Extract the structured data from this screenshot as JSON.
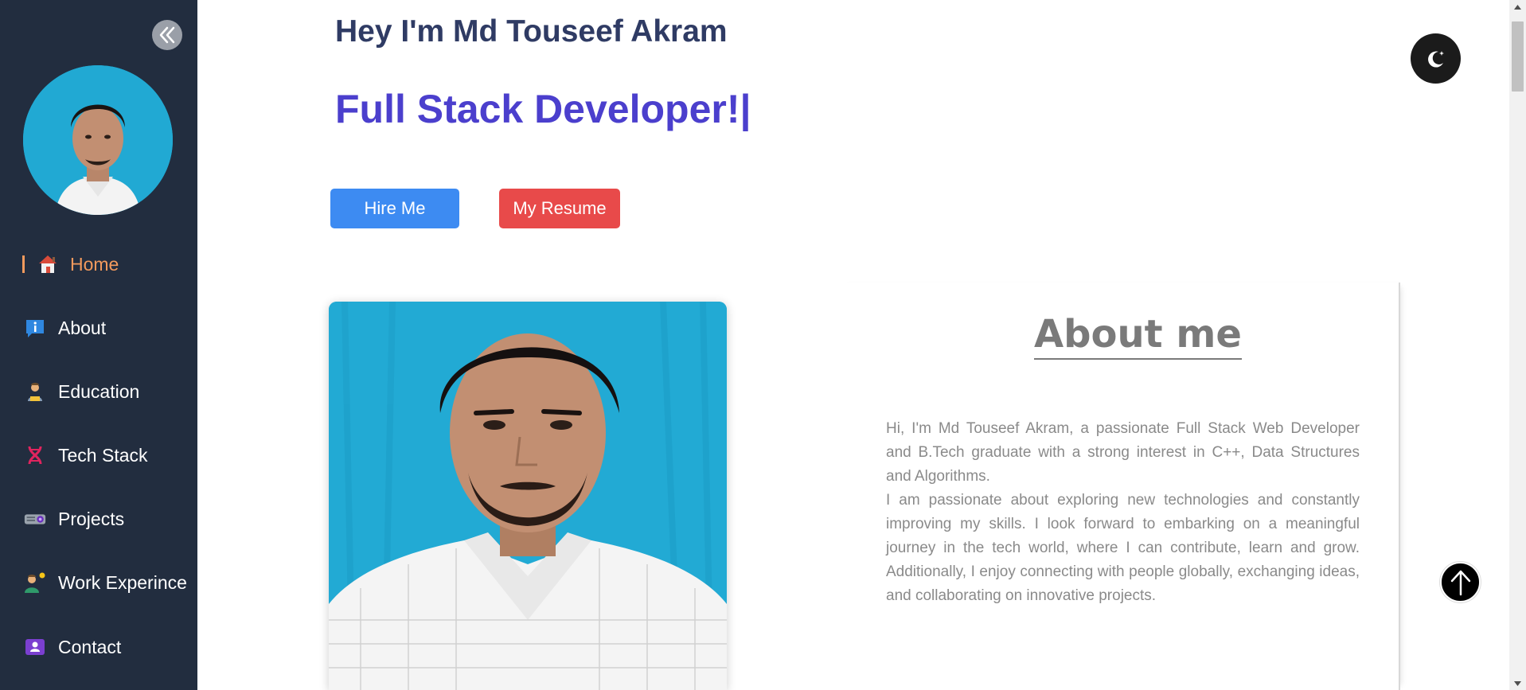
{
  "sidebar": {
    "items": [
      {
        "label": "Home",
        "icon": "home-icon",
        "active": true
      },
      {
        "label": "About",
        "icon": "info-icon"
      },
      {
        "label": "Education",
        "icon": "student-icon"
      },
      {
        "label": "Tech Stack",
        "icon": "dna-icon"
      },
      {
        "label": "Projects",
        "icon": "projector-icon"
      },
      {
        "label": "Work Experince",
        "icon": "worker-icon"
      },
      {
        "label": "Contact",
        "icon": "contact-card-icon"
      }
    ]
  },
  "hero": {
    "greeting": "Hey I'm Md Touseef Akram",
    "role": "Full Stack Developer!|",
    "hire_label": "Hire Me",
    "resume_label": "My Resume"
  },
  "about": {
    "title": "About me",
    "paragraph1": "Hi, I'm Md Touseef Akram, a passionate Full Stack Web Developer and B.Tech graduate with a strong interest in C++, Data Structures and Algorithms.",
    "paragraph2": "I am passionate about exploring new technologies and constantly improving my skills. I look forward to embarking on a meaningful journey in the tech world, where I can contribute, learn and grow. Additionally, I enjoy connecting with people globally, exchanging ideas, and collaborating on innovative projects."
  },
  "colors": {
    "sidebar_bg": "#222d3f",
    "accent_orange": "#f39a5d",
    "role_purple": "#4b3fcd",
    "hire_blue": "#3d8bf2",
    "resume_red": "#e84a4a"
  }
}
